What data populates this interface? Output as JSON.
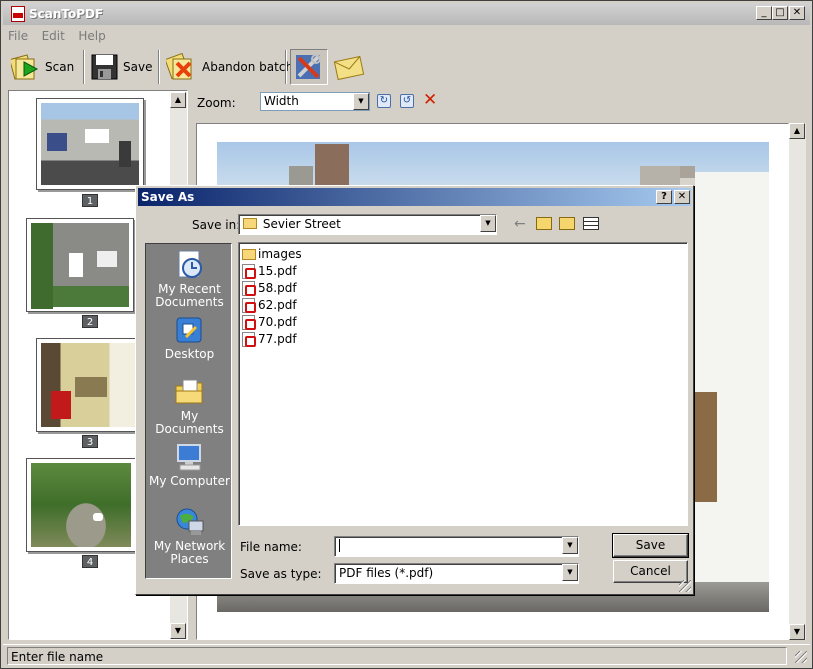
{
  "window": {
    "title": "ScanToPDF"
  },
  "caption_buttons": {
    "minimize": "_",
    "maximize": "□",
    "close": "✕"
  },
  "menu": [
    "File",
    "Edit",
    "Help"
  ],
  "toolbar": {
    "scan": "Scan",
    "save": "Save",
    "abandon": "Abandon batch"
  },
  "thumbnails": [
    {
      "page": "1"
    },
    {
      "page": "2"
    },
    {
      "page": "3"
    },
    {
      "page": "4"
    }
  ],
  "zoom": {
    "label": "Zoom:",
    "value": "Width"
  },
  "status": {
    "text": "Enter file name"
  },
  "dialog": {
    "title": "Save As",
    "help": "?",
    "close": "✕",
    "save_in_label": "Save in:",
    "save_in_value": "Sevier Street",
    "places": [
      "My Recent Documents",
      "Desktop",
      "My Documents",
      "My Computer",
      "My Network Places"
    ],
    "files": [
      "images",
      "15.pdf",
      "58.pdf",
      "62.pdf",
      "70.pdf",
      "77.pdf"
    ],
    "file_name_label": "File name:",
    "file_name_value": "",
    "save_type_label": "Save as type:",
    "save_type_value": "PDF files (*.pdf)",
    "save_button": "Save",
    "cancel_button": "Cancel"
  },
  "colors": {
    "dialog_title_start": "#0a246a",
    "dialog_title_end": "#a6caf0",
    "delete": "#d02000",
    "window_face": "#d4d0c8"
  }
}
